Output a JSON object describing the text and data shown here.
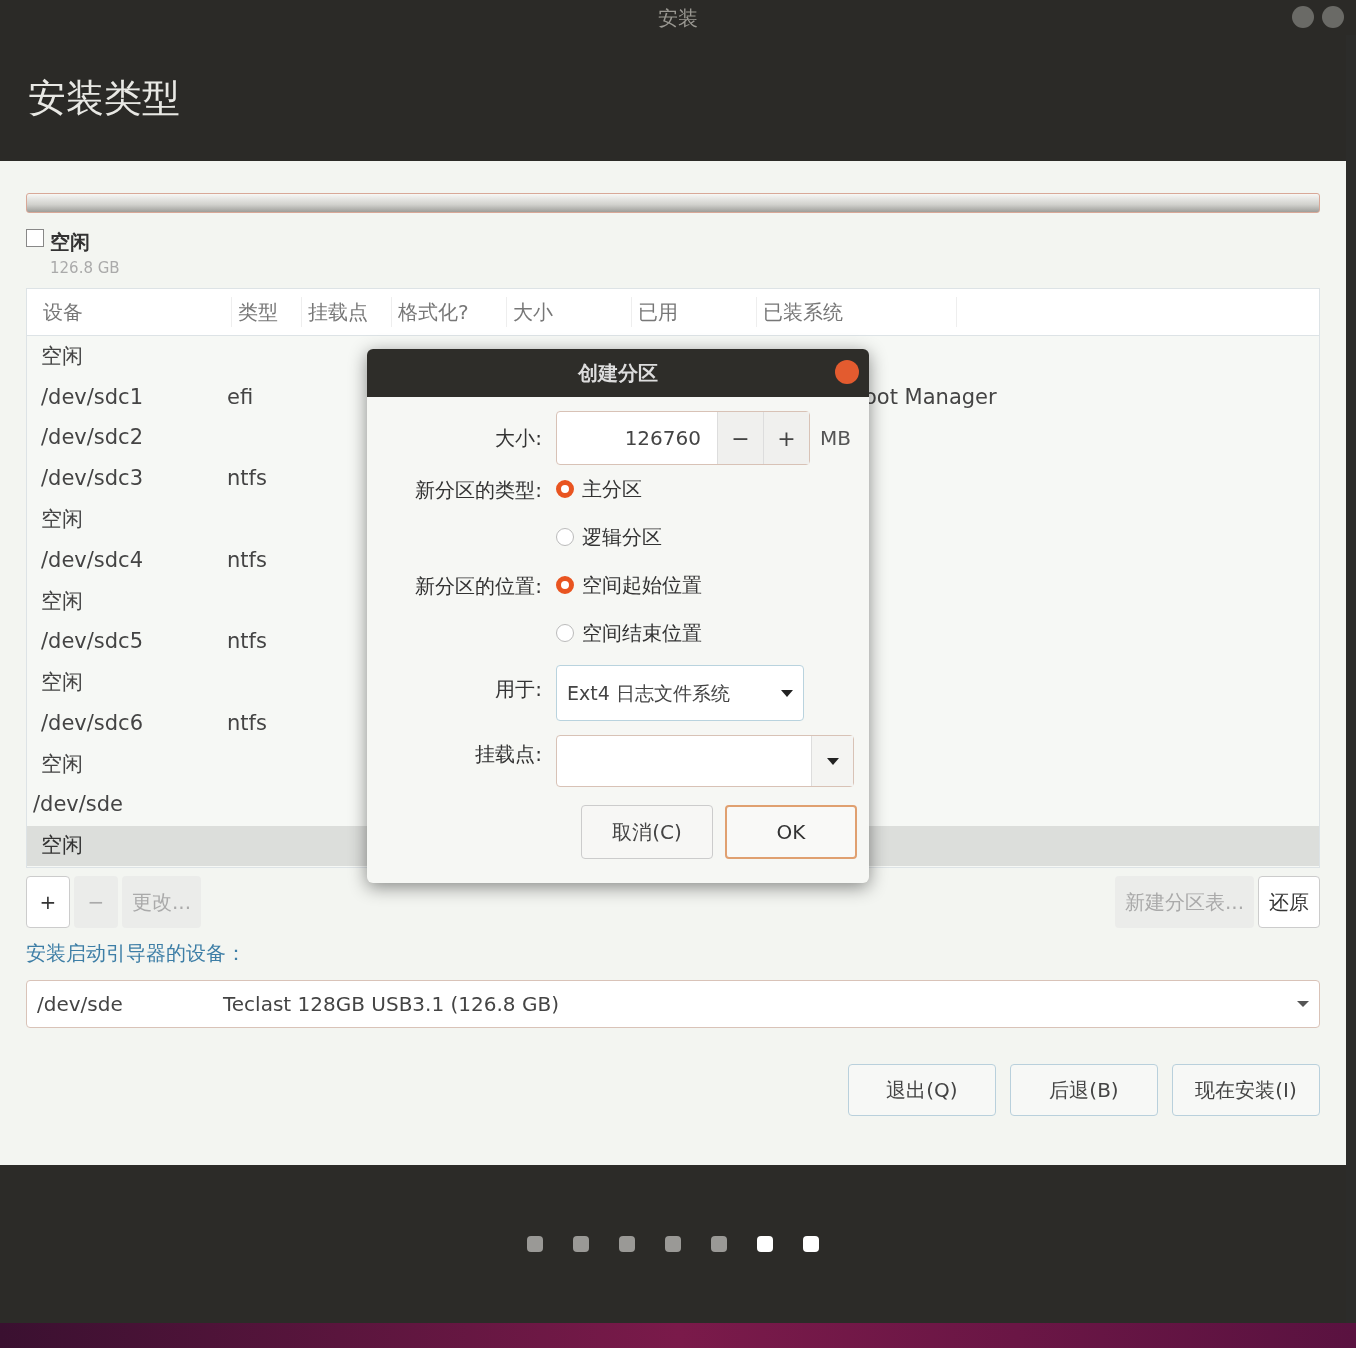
{
  "window": {
    "title": "安装"
  },
  "header": {
    "title": "安装类型"
  },
  "legend": {
    "checked": false,
    "label": "空闲",
    "size": "126.8 GB"
  },
  "table": {
    "columns": [
      "设备",
      "类型",
      "挂载点",
      "格式化?",
      "大小",
      "已用",
      "已装系统"
    ],
    "rows": [
      {
        "children": [
          {
            "device": "空闲",
            "selected": false
          },
          {
            "device": "/dev/sdc1",
            "type": "efi",
            "system": "oot Manager",
            "selected": false
          },
          {
            "device": "/dev/sdc2",
            "selected": false
          },
          {
            "device": "/dev/sdc3",
            "type": "ntfs",
            "selected": false
          },
          {
            "device": "空闲",
            "selected": false
          },
          {
            "device": "/dev/sdc4",
            "type": "ntfs",
            "selected": false
          },
          {
            "device": "空闲",
            "selected": false
          },
          {
            "device": "/dev/sdc5",
            "type": "ntfs",
            "selected": false
          },
          {
            "device": "空闲",
            "selected": false
          },
          {
            "device": "/dev/sdc6",
            "type": "ntfs",
            "selected": false
          },
          {
            "device": "空闲",
            "selected": false
          }
        ]
      },
      {
        "device": "/dev/sde",
        "selected": false,
        "children": [
          {
            "device": "空闲",
            "selected": true
          }
        ]
      }
    ]
  },
  "table_buttons": {
    "left": [
      {
        "label": "+",
        "disabled": false
      },
      {
        "label": "−",
        "disabled": true
      },
      {
        "label": "更改...",
        "disabled": true
      }
    ],
    "right": [
      {
        "label": "新建分区表...",
        "disabled": true
      },
      {
        "label": "还原",
        "disabled": false
      }
    ]
  },
  "bootloader": {
    "label": "安装启动引导器的设备：",
    "device": "/dev/sde",
    "description": "Teclast 128GB USB3.1 (126.8 GB)"
  },
  "buttons": [
    "退出(Q)",
    "后退(B)",
    "现在安装(I)"
  ],
  "steps": [
    {
      "lit": false
    },
    {
      "lit": false
    },
    {
      "lit": false
    },
    {
      "lit": false
    },
    {
      "lit": false
    },
    {
      "lit": true
    },
    {
      "lit": true
    }
  ],
  "dialog": {
    "title": "创建分区",
    "size_label": "大小:",
    "size_value": "126760",
    "minus": "−",
    "plus": "+",
    "unit": "MB",
    "type_label": "新分区的类型:",
    "types": [
      {
        "label": "主分区",
        "selected": true
      },
      {
        "label": "逻辑分区",
        "selected": false
      }
    ],
    "location_label": "新分区的位置:",
    "locations": [
      {
        "label": "空间起始位置",
        "selected": true
      },
      {
        "label": "空间结束位置",
        "selected": false
      }
    ],
    "use_label": "用于:",
    "use_value": "Ext4 日志文件系统",
    "mount_label": "挂载点:",
    "cancel": "取消(C)",
    "ok": "OK"
  }
}
